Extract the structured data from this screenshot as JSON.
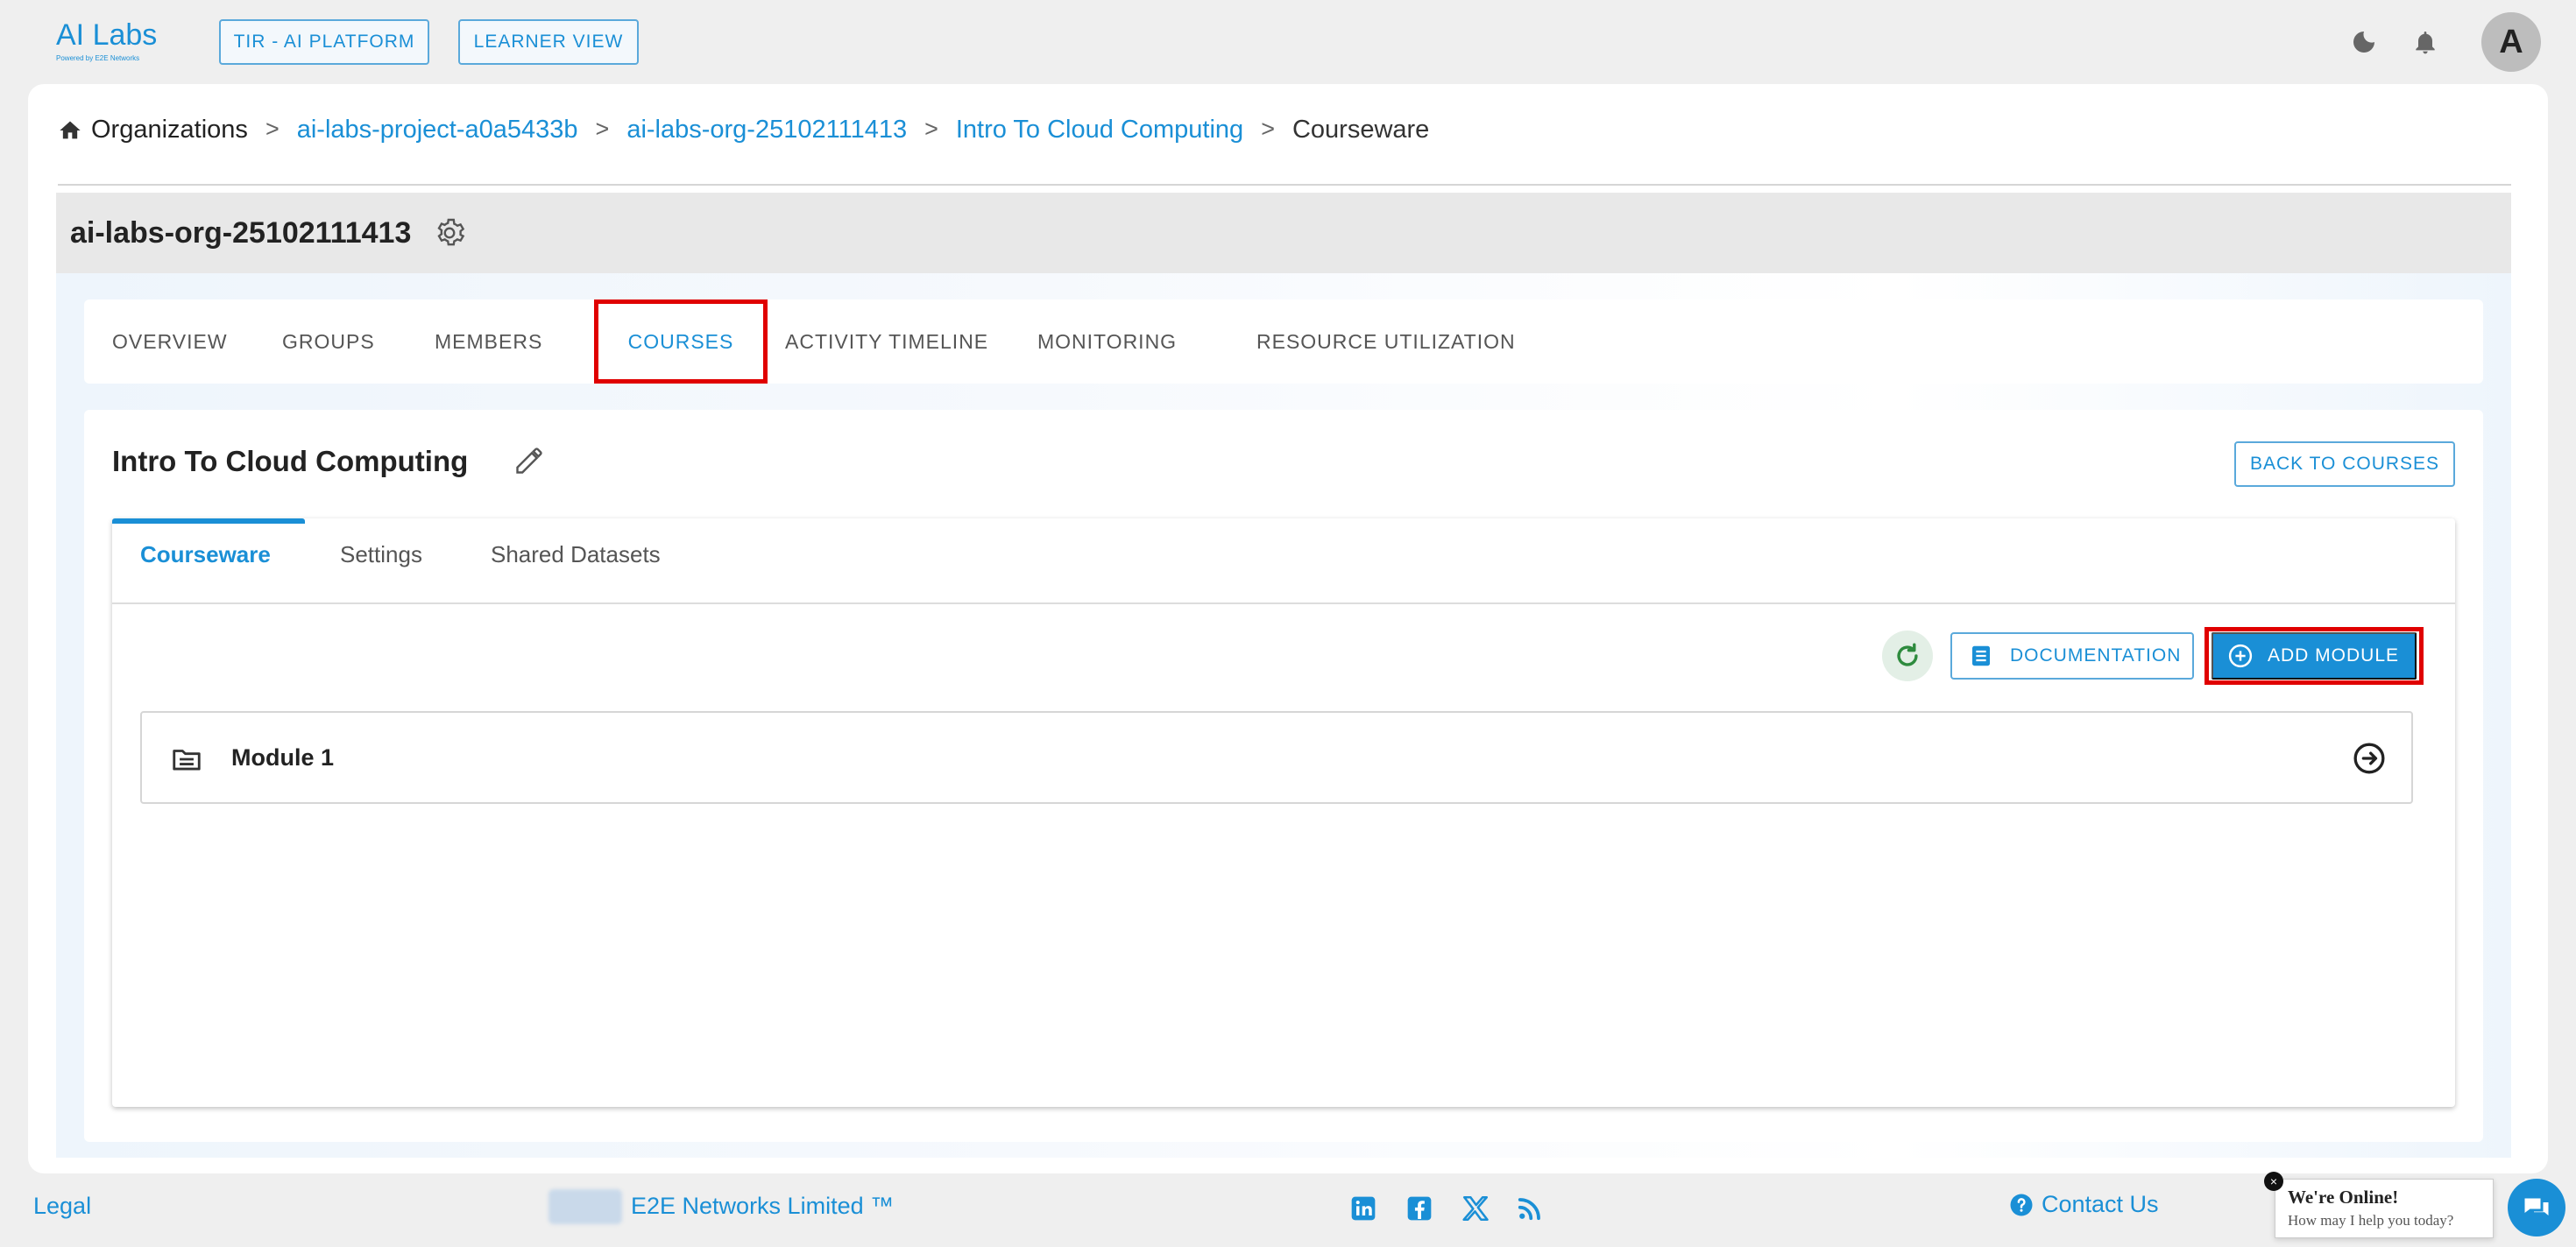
{
  "topbar": {
    "logo_main": "AI Labs",
    "logo_sub": "Powered by E2E Networks",
    "tir_button": "TIR - AI PLATFORM",
    "learner_button": "LEARNER VIEW",
    "avatar_initial": "A"
  },
  "breadcrumb": {
    "home": "Organizations",
    "items": [
      "ai-labs-project-a0a5433b",
      "ai-labs-org-25102111413",
      "Intro To Cloud Computing"
    ],
    "current": "Courseware",
    "separator": ">"
  },
  "org": {
    "title": "ai-labs-org-25102111413"
  },
  "tabs": {
    "items": [
      "OVERVIEW",
      "GROUPS",
      "MEMBERS",
      "COURSES",
      "ACTIVITY TIMELINE",
      "MONITORING",
      "RESOURCE UTILIZATION"
    ],
    "active": "COURSES"
  },
  "course": {
    "title": "Intro To Cloud Computing",
    "back_button": "BACK TO COURSES"
  },
  "subtabs": {
    "items": [
      "Courseware",
      "Settings",
      "Shared Datasets"
    ],
    "active": "Courseware"
  },
  "toolbar": {
    "documentation_label": "DOCUMENTATION",
    "add_module_label": "ADD MODULE"
  },
  "modules": [
    {
      "title": "Module 1"
    }
  ],
  "footer": {
    "legal": "Legal",
    "company": "E2E Networks Limited ™",
    "contact": "Contact Us"
  },
  "chat": {
    "title": "We're Online!",
    "subtitle": "How may I help you today?",
    "close": "×"
  },
  "colors": {
    "accent": "#1a8fd6",
    "highlight": "#e00000",
    "background": "#efefef"
  }
}
